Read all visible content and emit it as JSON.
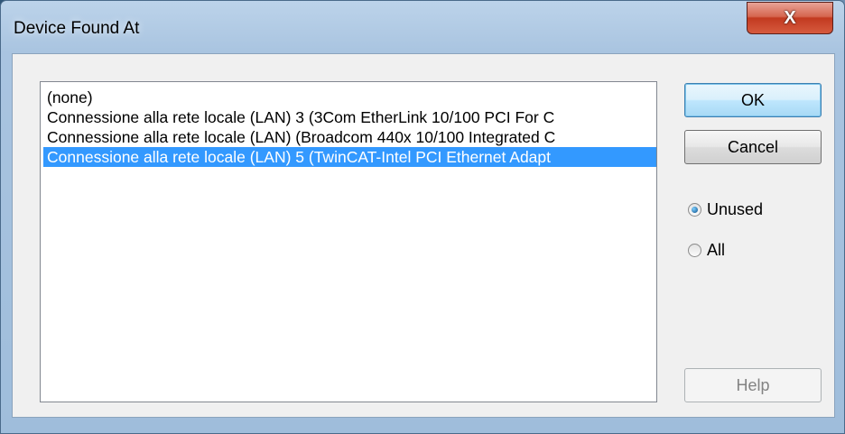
{
  "window": {
    "title": "Device Found At",
    "close_label": "X"
  },
  "list": {
    "items": [
      {
        "label": "(none)",
        "selected": false
      },
      {
        "label": "Connessione alla rete locale (LAN) 3 (3Com EtherLink 10/100 PCI For C",
        "selected": false
      },
      {
        "label": "Connessione alla rete locale (LAN) (Broadcom 440x 10/100 Integrated C",
        "selected": false
      },
      {
        "label": "Connessione alla rete locale (LAN) 5 (TwinCAT-Intel PCI Ethernet Adapt",
        "selected": true
      }
    ]
  },
  "buttons": {
    "ok": "OK",
    "cancel": "Cancel",
    "help": "Help"
  },
  "filter": {
    "unused_label": "Unused",
    "all_label": "All",
    "selected": "Unused"
  }
}
